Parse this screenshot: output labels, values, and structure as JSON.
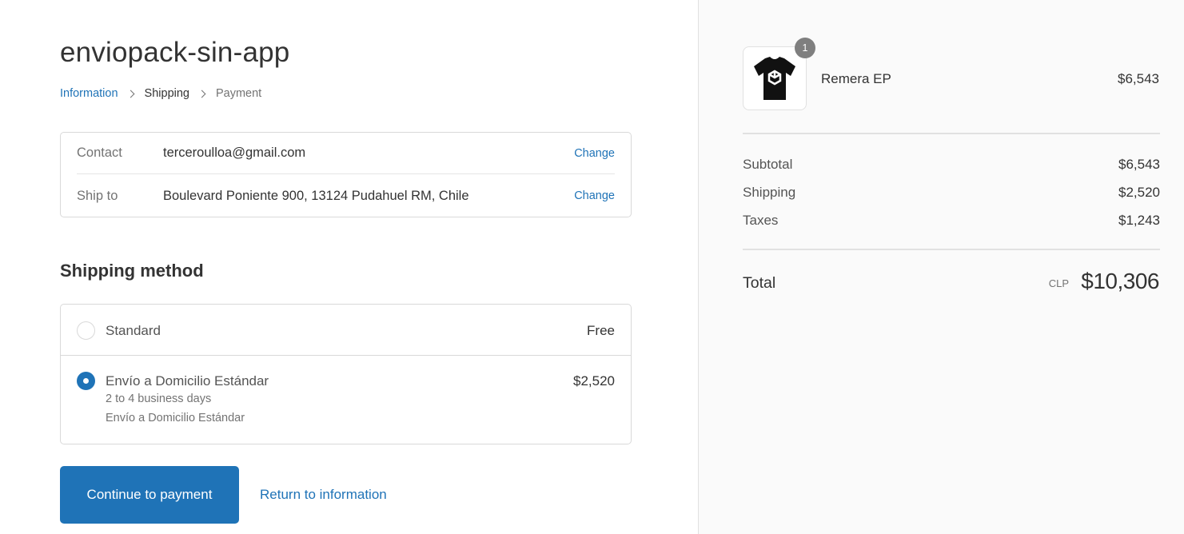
{
  "store": {
    "title": "enviopack-sin-app"
  },
  "breadcrumb": {
    "information": "Information",
    "shipping": "Shipping",
    "payment": "Payment"
  },
  "review": {
    "contact_label": "Contact",
    "contact_value": "terceroulloa@gmail.com",
    "ship_label": "Ship to",
    "ship_value": "Boulevard Poniente 900, 13124 Pudahuel RM, Chile",
    "change_label": "Change"
  },
  "shipping_method": {
    "title": "Shipping method",
    "options": [
      {
        "name": "Standard",
        "price": "Free",
        "selected": false
      },
      {
        "name": "Envío a Domicilio Estándar",
        "price": "$2,520",
        "eta": "2 to 4 business days",
        "description": "Envío a Domicilio Estándar",
        "selected": true
      }
    ]
  },
  "actions": {
    "continue_label": "Continue to payment",
    "return_label": "Return to information"
  },
  "summary": {
    "product": {
      "name": "Remera EP",
      "price": "$6,543",
      "quantity": "1"
    },
    "subtotal_label": "Subtotal",
    "subtotal_value": "$6,543",
    "shipping_label": "Shipping",
    "shipping_value": "$2,520",
    "taxes_label": "Taxes",
    "taxes_value": "$1,243",
    "total_label": "Total",
    "total_currency": "CLP",
    "total_value": "$10,306"
  },
  "colors": {
    "accent": "#1f73b7",
    "sidebar_bg": "#fafafa",
    "badge": "#7f7f7f"
  },
  "icons": {
    "breadcrumb_separator": "chevron-right-icon",
    "product_image": "tshirt-icon"
  }
}
